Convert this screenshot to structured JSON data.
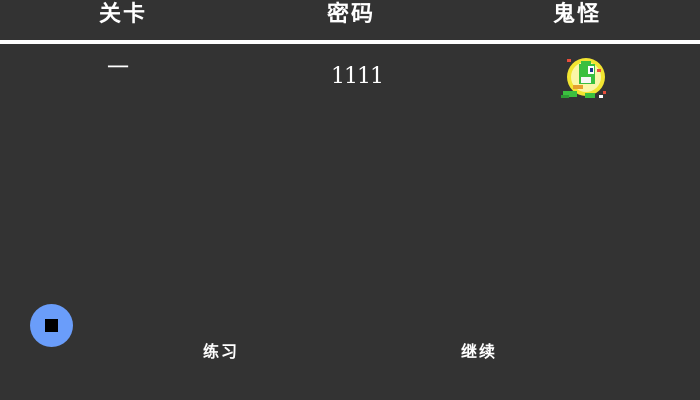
{
  "header": {
    "level_label": "关卡",
    "password_label": "密码",
    "monster_label": "鬼怪"
  },
  "rows": [
    {
      "level": "一",
      "password": "1111",
      "monster_icon": "green-dragon-in-bubble-icon"
    }
  ],
  "controls": {
    "stop_icon": "stop-icon",
    "practice_label": "练习",
    "continue_label": "继续"
  },
  "colors": {
    "background": "#333333",
    "text": "#ffffff",
    "stop_button": "#6a9dfa",
    "bubble": "#f2e531",
    "dragon": "#3bbf3f"
  }
}
